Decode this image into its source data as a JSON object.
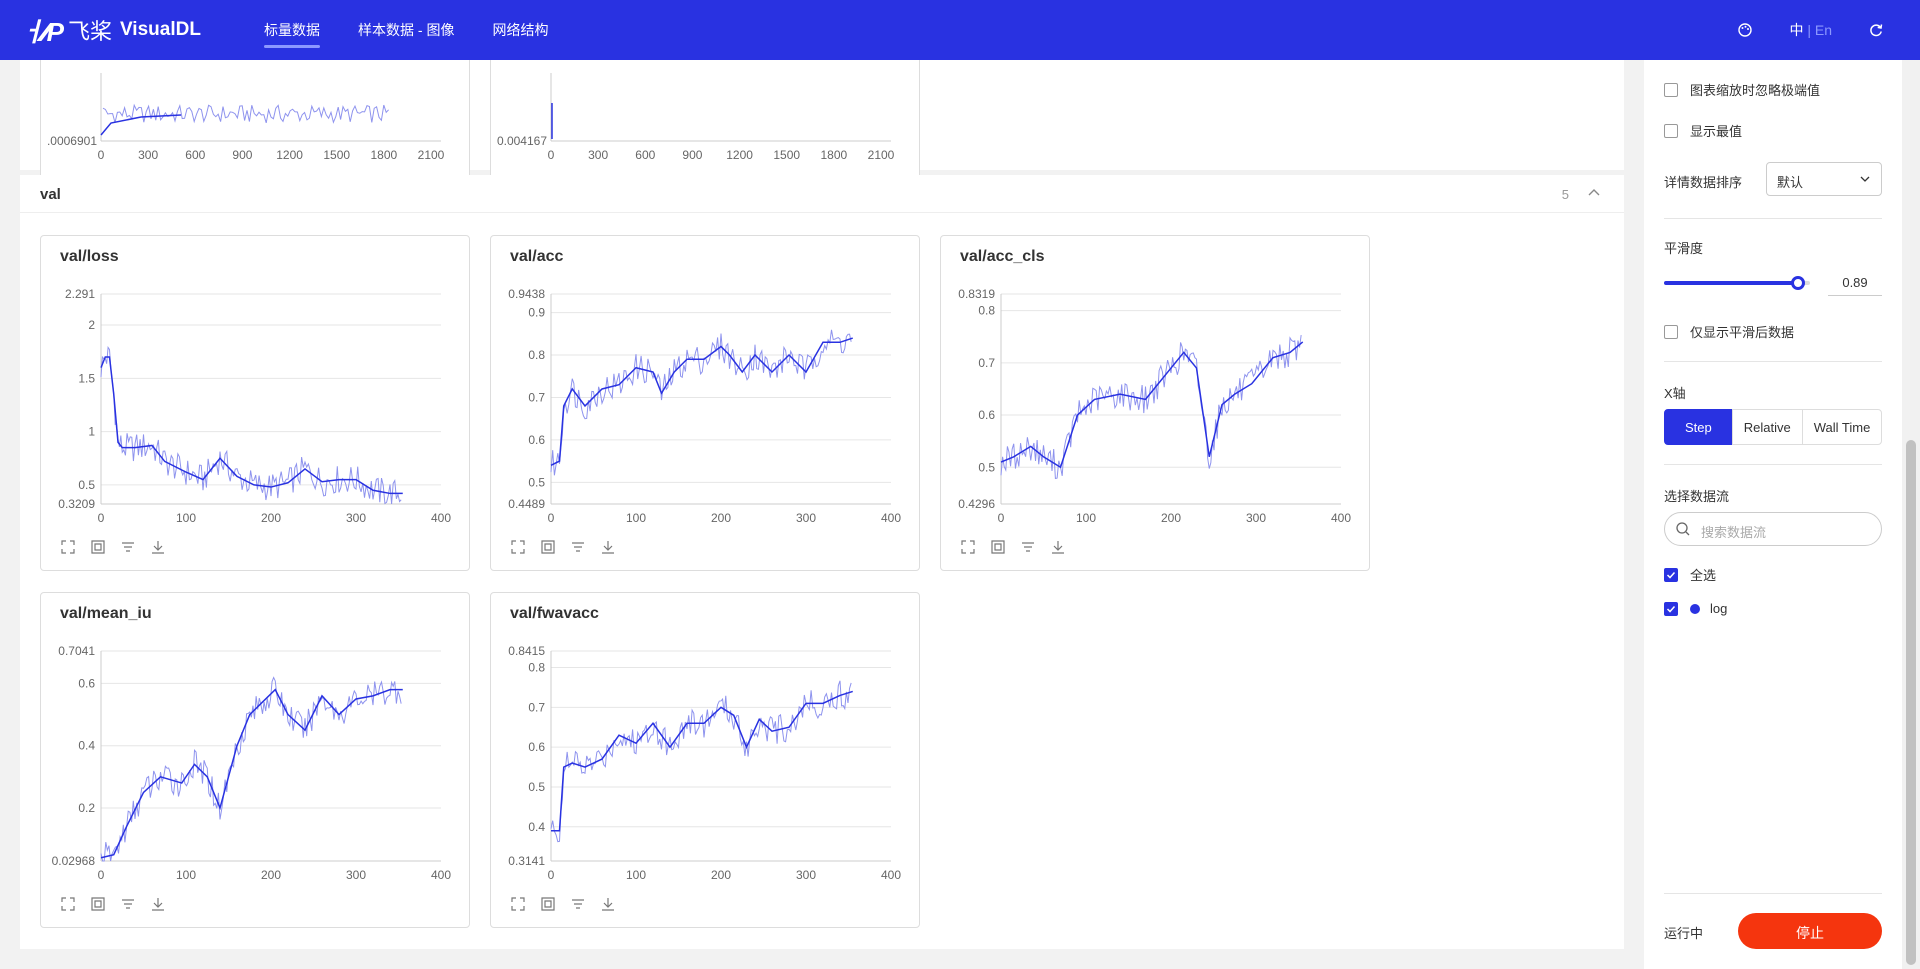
{
  "header": {
    "logo_cn": "飞桨",
    "logo_text": "VisualDL",
    "nav": [
      "标量数据",
      "样本数据 - 图像",
      "网络结构"
    ],
    "lang_active": "中",
    "lang_sep": "|",
    "lang_other": "En"
  },
  "top_cards": [
    {
      "y_min_label": ".0006901",
      "x_ticks": [
        "0",
        "300",
        "600",
        "900",
        "1200",
        "1500",
        "1800",
        "2100"
      ]
    },
    {
      "y_min_label": "0.004167",
      "x_ticks": [
        "0",
        "300",
        "600",
        "900",
        "1200",
        "1500",
        "1800",
        "2100"
      ]
    }
  ],
  "group": {
    "name": "val",
    "count": "5"
  },
  "chart_data": [
    {
      "type": "line",
      "title": "val/loss",
      "ylim": [
        0.3209,
        2.291
      ],
      "y_ticks": [
        "2.291",
        "2",
        "1.5",
        "1",
        "0.5",
        "0.3209"
      ],
      "y_tick_values": [
        2.291,
        2,
        1.5,
        1,
        0.5,
        0.3209
      ],
      "xlim": [
        0,
        400
      ],
      "x_ticks": [
        "0",
        "100",
        "200",
        "300",
        "400"
      ],
      "series": [
        {
          "name": "log",
          "x": [
            0,
            5,
            10,
            15,
            20,
            25,
            40,
            60,
            75,
            100,
            120,
            140,
            160,
            180,
            200,
            220,
            240,
            260,
            280,
            300,
            320,
            340,
            355
          ],
          "values": [
            1.6,
            1.7,
            1.7,
            1.35,
            0.9,
            0.85,
            0.85,
            0.87,
            0.72,
            0.62,
            0.55,
            0.75,
            0.58,
            0.5,
            0.48,
            0.52,
            0.65,
            0.53,
            0.55,
            0.55,
            0.45,
            0.42,
            0.42
          ]
        }
      ]
    },
    {
      "type": "line",
      "title": "val/acc",
      "ylim": [
        0.4489,
        0.9438
      ],
      "y_ticks": [
        "0.9438",
        "0.9",
        "0.8",
        "0.7",
        "0.6",
        "0.5",
        "0.4489"
      ],
      "y_tick_values": [
        0.9438,
        0.9,
        0.8,
        0.7,
        0.6,
        0.5,
        0.4489
      ],
      "xlim": [
        0,
        400
      ],
      "x_ticks": [
        "0",
        "100",
        "200",
        "300",
        "400"
      ],
      "series": [
        {
          "name": "log",
          "x": [
            0,
            10,
            15,
            25,
            40,
            60,
            80,
            100,
            120,
            130,
            145,
            160,
            180,
            200,
            210,
            225,
            240,
            260,
            280,
            300,
            320,
            340,
            355
          ],
          "values": [
            0.54,
            0.55,
            0.68,
            0.72,
            0.68,
            0.72,
            0.73,
            0.77,
            0.76,
            0.71,
            0.76,
            0.79,
            0.79,
            0.82,
            0.8,
            0.76,
            0.8,
            0.76,
            0.8,
            0.76,
            0.83,
            0.83,
            0.84
          ]
        }
      ]
    },
    {
      "type": "line",
      "title": "val/acc_cls",
      "ylim": [
        0.4296,
        0.8319
      ],
      "y_ticks": [
        "0.8319",
        "0.8",
        "0.7",
        "0.6",
        "0.5",
        "0.4296"
      ],
      "y_tick_values": [
        0.8319,
        0.8,
        0.7,
        0.6,
        0.5,
        0.4296
      ],
      "xlim": [
        0,
        400
      ],
      "x_ticks": [
        "0",
        "100",
        "200",
        "300",
        "400"
      ],
      "series": [
        {
          "name": "log",
          "x": [
            0,
            15,
            35,
            50,
            70,
            90,
            110,
            140,
            170,
            200,
            215,
            230,
            245,
            260,
            275,
            295,
            320,
            340,
            355
          ],
          "values": [
            0.51,
            0.52,
            0.54,
            0.52,
            0.5,
            0.6,
            0.63,
            0.64,
            0.63,
            0.69,
            0.72,
            0.69,
            0.52,
            0.62,
            0.64,
            0.66,
            0.71,
            0.72,
            0.74
          ]
        }
      ]
    },
    {
      "type": "line",
      "title": "val/mean_iu",
      "ylim": [
        0.02968,
        0.7041
      ],
      "y_ticks": [
        "0.7041",
        "0.6",
        "0.4",
        "0.2",
        "0.02968"
      ],
      "y_tick_values": [
        0.7041,
        0.6,
        0.4,
        0.2,
        0.02968
      ],
      "xlim": [
        0,
        400
      ],
      "x_ticks": [
        "0",
        "100",
        "200",
        "300",
        "400"
      ],
      "series": [
        {
          "name": "log",
          "x": [
            0,
            15,
            30,
            50,
            70,
            95,
            110,
            125,
            140,
            160,
            175,
            190,
            205,
            220,
            240,
            260,
            280,
            300,
            320,
            340,
            355
          ],
          "values": [
            0.04,
            0.05,
            0.14,
            0.25,
            0.3,
            0.28,
            0.34,
            0.3,
            0.2,
            0.4,
            0.5,
            0.54,
            0.58,
            0.5,
            0.45,
            0.56,
            0.5,
            0.55,
            0.56,
            0.58,
            0.58
          ]
        }
      ]
    },
    {
      "type": "line",
      "title": "val/fwavacc",
      "ylim": [
        0.3141,
        0.8415
      ],
      "y_ticks": [
        "0.8415",
        "0.8",
        "0.7",
        "0.6",
        "0.5",
        "0.4",
        "0.3141"
      ],
      "y_tick_values": [
        0.8415,
        0.8,
        0.7,
        0.6,
        0.5,
        0.4,
        0.3141
      ],
      "xlim": [
        0,
        400
      ],
      "x_ticks": [
        "0",
        "100",
        "200",
        "300",
        "400"
      ],
      "series": [
        {
          "name": "log",
          "x": [
            0,
            10,
            15,
            25,
            40,
            60,
            80,
            100,
            120,
            140,
            160,
            180,
            200,
            215,
            230,
            245,
            260,
            280,
            300,
            320,
            340,
            355
          ],
          "values": [
            0.39,
            0.39,
            0.55,
            0.56,
            0.55,
            0.57,
            0.63,
            0.61,
            0.66,
            0.6,
            0.66,
            0.66,
            0.7,
            0.68,
            0.6,
            0.67,
            0.64,
            0.65,
            0.71,
            0.71,
            0.73,
            0.74
          ]
        }
      ]
    }
  ],
  "sidebar": {
    "ignore_outliers": "图表缩放时忽略极端值",
    "show_extreme": "显示最值",
    "sort_label": "详情数据排序",
    "sort_value": "默认",
    "smoothing_label": "平滑度",
    "smoothing_value": "0.89",
    "smoothing_fraction": 0.89,
    "only_smoothed": "仅显示平滑后数据",
    "xaxis_label": "X轴",
    "xaxis_options": [
      "Step",
      "Relative",
      "Wall Time"
    ],
    "xaxis_selected": "Step",
    "stream_label": "选择数据流",
    "search_placeholder": "搜索数据流",
    "select_all": "全选",
    "stream_name": "log",
    "status": "运行中",
    "stop": "停止"
  },
  "colors": {
    "brand": "#2932e1",
    "raw_line": "#8e93ee",
    "stop": "#f5350e"
  }
}
